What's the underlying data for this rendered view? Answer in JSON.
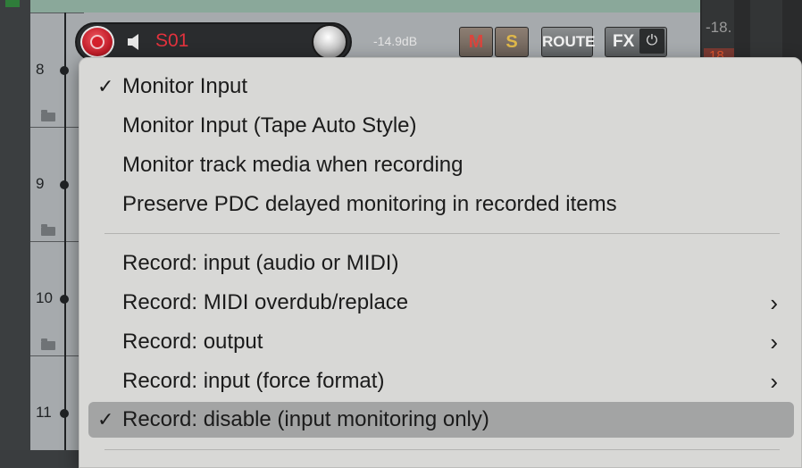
{
  "tracks": [
    {
      "number": "8"
    },
    {
      "number": "9"
    },
    {
      "number": "10"
    },
    {
      "number": "11"
    }
  ],
  "track_header": {
    "name": "S01",
    "volume": "-14.9dB",
    "mute_label": "M",
    "solo_label": "S",
    "route_label": "ROUTE",
    "fx_label": "FX",
    "fx_power_icon": "⏻"
  },
  "meter": {
    "peak_top": "-18.",
    "peak_red": "18"
  },
  "menu": {
    "group1": [
      {
        "label": "Monitor Input",
        "checked": true,
        "submenu": false
      },
      {
        "label": "Monitor Input (Tape Auto Style)",
        "checked": false,
        "submenu": false
      },
      {
        "label": "Monitor track media when recording",
        "checked": false,
        "submenu": false
      },
      {
        "label": "Preserve PDC delayed monitoring in recorded items",
        "checked": false,
        "submenu": false
      }
    ],
    "group2": [
      {
        "label": "Record: input (audio or MIDI)",
        "checked": false,
        "submenu": false
      },
      {
        "label": "Record: MIDI overdub/replace",
        "checked": false,
        "submenu": true
      },
      {
        "label": "Record: output",
        "checked": false,
        "submenu": true
      },
      {
        "label": "Record: input (force format)",
        "checked": false,
        "submenu": true
      },
      {
        "label": "Record: disable (input monitoring only)",
        "checked": true,
        "submenu": false
      }
    ],
    "check_glyph": "✓",
    "arrow_glyph": "›"
  },
  "colors": {
    "record_red": "#d4202c",
    "track_name_red": "#e2323d",
    "menu_bg": "#d8d8d6",
    "highlight": "#a3a4a4"
  }
}
